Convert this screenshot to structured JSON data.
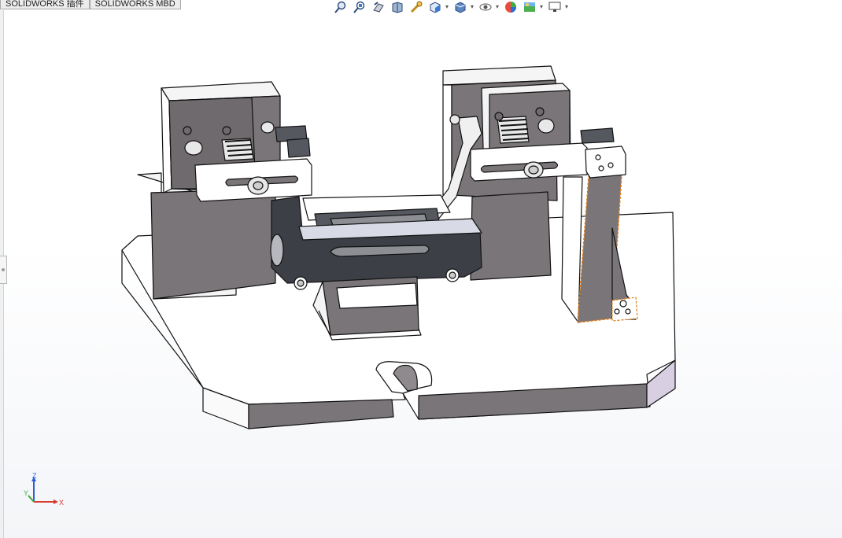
{
  "tabs": [
    {
      "label": "SOLIDWORKS 插件"
    },
    {
      "label": "SOLIDWORKS MBD"
    }
  ],
  "toolbar_icons": [
    "zoom-to-fit-icon",
    "zoom-to-area-icon",
    "previous-view-icon",
    "section-view-icon",
    "dynamic-annotation-icon",
    "view-orientation-icon",
    "display-style-icon",
    "hide-show-items-icon",
    "edit-appearance-icon",
    "apply-scene-icon",
    "view-settings-icon"
  ],
  "triad": {
    "x_label": "X",
    "y_label": "Y",
    "z_label": "Z"
  },
  "colors": {
    "part_gray": "#7a7578",
    "part_light": "#ffffff",
    "edge": "#111111",
    "selection": "#e07b10",
    "background": "#ffffff"
  }
}
